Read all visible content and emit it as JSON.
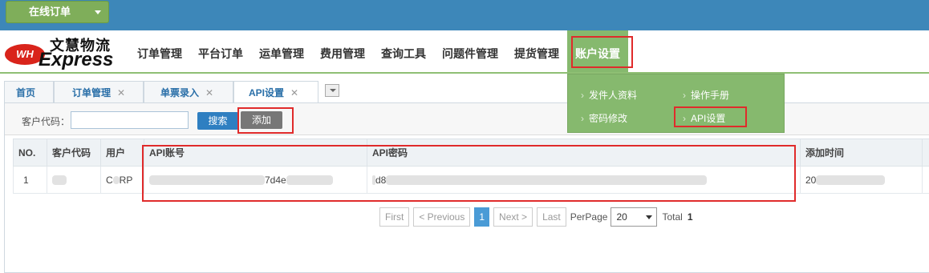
{
  "topbar": {
    "online_order": "在线订单"
  },
  "logo": {
    "cn": "文慧物流",
    "en": "Express",
    "badge": "WH"
  },
  "nav": {
    "items": [
      "订单管理",
      "平台订单",
      "运单管理",
      "费用管理",
      "查询工具",
      "问题件管理",
      "提货管理",
      "账户设置"
    ],
    "active": "账户设置"
  },
  "dropdown": {
    "items": [
      {
        "label": "发件人资料"
      },
      {
        "label": "操作手册"
      },
      {
        "label": "密码修改"
      },
      {
        "label": "API设置"
      }
    ]
  },
  "tabs": [
    {
      "label": "首页",
      "closable": false
    },
    {
      "label": "订单管理",
      "closable": true
    },
    {
      "label": "单票录入",
      "closable": true
    },
    {
      "label": "API设置",
      "closable": true,
      "active": true
    }
  ],
  "toolbar": {
    "customer_code_label": "客户代码：",
    "customer_code_value": "",
    "search_label": "搜索",
    "add_label": "添加"
  },
  "table": {
    "columns": [
      "NO.",
      "客户代码",
      "用户",
      "API账号",
      "API密码",
      "添加时间"
    ],
    "rows": [
      {
        "no": "1",
        "customer_code": "",
        "user_prefix": "C",
        "user_suffix": "RP",
        "api_account_suffix": "7d4e",
        "api_password_prefix": "d8",
        "added_time_prefix": "20"
      }
    ]
  },
  "pager": {
    "first": "First",
    "prev": "< Previous",
    "current_page": "1",
    "next": "Next >",
    "last": "Last",
    "per_page_label": "PerPage",
    "per_page_value": "20",
    "total_label": "Total",
    "total_value": "1"
  },
  "colors": {
    "topbar": "#3d87b9",
    "accent_green": "#86b96e",
    "highlight_red": "#e02b2b",
    "primary_blue": "#2f7fc1"
  }
}
